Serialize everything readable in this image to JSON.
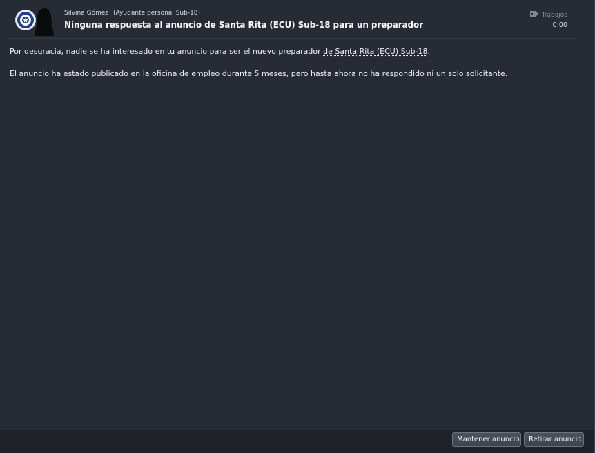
{
  "message": {
    "sender_name": "Silvina Gómez",
    "sender_role": "(Ayudante personal Sub-18)",
    "subject": "Ninguna respuesta al anuncio de Santa Rita (ECU) Sub-18 para un preparador",
    "category": "Trabajos",
    "category_icon": "tag-icon",
    "time": "0:00"
  },
  "body": {
    "p1_before": "Por desgracia, nadie se ha interesado en tu anuncio para ser el nuevo preparador ",
    "p1_link": "de Santa Rita (ECU) Sub-18",
    "p1_after": ".",
    "p2": "El anuncio ha estado publicado en la oficina de empleo durante 5 meses, pero hasta ahora no ha respondido ni un solo solicitante."
  },
  "actions": {
    "keep_label": "Mantener anuncio",
    "withdraw_label": "Retirar anuncio"
  },
  "colors": {
    "background": "#272b34",
    "footer": "#1f2228",
    "crest_blue": "#1f3f8f"
  }
}
